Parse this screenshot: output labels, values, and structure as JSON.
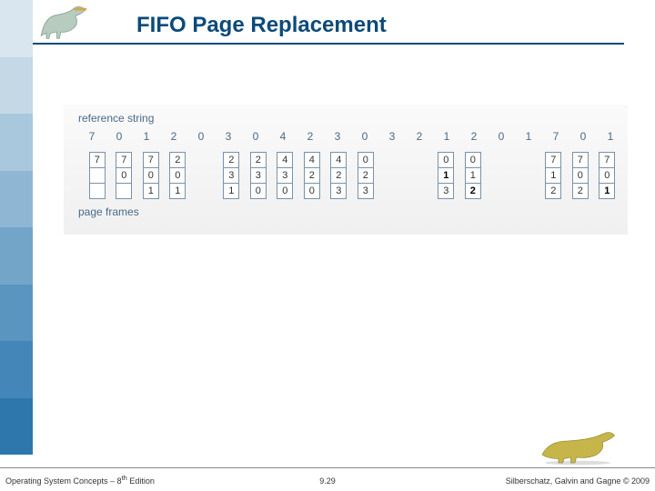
{
  "title": "FIFO Page Replacement",
  "labels": {
    "refstring": "reference string",
    "frames": "page frames"
  },
  "reference_string": [
    "7",
    "0",
    "1",
    "2",
    "0",
    "3",
    "0",
    "4",
    "2",
    "3",
    "0",
    "3",
    "2",
    "1",
    "2",
    "0",
    "1",
    "7",
    "0",
    "1"
  ],
  "columns": [
    {
      "show": true,
      "frames": [
        "7",
        "",
        ""
      ],
      "hl": [
        false,
        false,
        false
      ]
    },
    {
      "show": true,
      "frames": [
        "7",
        "0",
        ""
      ],
      "hl": [
        false,
        false,
        false
      ]
    },
    {
      "show": true,
      "frames": [
        "7",
        "0",
        "1"
      ],
      "hl": [
        false,
        false,
        false
      ]
    },
    {
      "show": true,
      "frames": [
        "2",
        "0",
        "1"
      ],
      "hl": [
        false,
        false,
        false
      ]
    },
    {
      "show": false
    },
    {
      "show": true,
      "frames": [
        "2",
        "3",
        "1"
      ],
      "hl": [
        false,
        false,
        false
      ]
    },
    {
      "show": true,
      "frames": [
        "2",
        "3",
        "0"
      ],
      "hl": [
        false,
        false,
        false
      ]
    },
    {
      "show": true,
      "frames": [
        "4",
        "3",
        "0"
      ],
      "hl": [
        false,
        false,
        false
      ]
    },
    {
      "show": true,
      "frames": [
        "4",
        "2",
        "0"
      ],
      "hl": [
        false,
        false,
        false
      ]
    },
    {
      "show": true,
      "frames": [
        "4",
        "2",
        "3"
      ],
      "hl": [
        false,
        false,
        false
      ]
    },
    {
      "show": true,
      "frames": [
        "0",
        "2",
        "3"
      ],
      "hl": [
        false,
        false,
        false
      ]
    },
    {
      "show": false
    },
    {
      "show": false
    },
    {
      "show": true,
      "frames": [
        "0",
        "1",
        "3"
      ],
      "hl": [
        false,
        true,
        false
      ]
    },
    {
      "show": true,
      "frames": [
        "0",
        "1",
        "2"
      ],
      "hl": [
        false,
        false,
        true
      ]
    },
    {
      "show": false
    },
    {
      "show": false
    },
    {
      "show": true,
      "frames": [
        "7",
        "1",
        "2"
      ],
      "hl": [
        false,
        false,
        false
      ]
    },
    {
      "show": true,
      "frames": [
        "7",
        "0",
        "2"
      ],
      "hl": [
        false,
        false,
        false
      ]
    },
    {
      "show": true,
      "frames": [
        "7",
        "0",
        "1"
      ],
      "hl": [
        false,
        false,
        true
      ]
    }
  ],
  "footer": {
    "left_prefix": "Operating System Concepts – 8",
    "left_sup": "th",
    "left_suffix": " Edition",
    "center": "9.29",
    "right": "Silberschatz, Galvin and Gagne © 2009"
  },
  "theme": {
    "stripe_colors": [
      "#d9e6ef",
      "#c4d8e6",
      "#a9c7dd",
      "#8fb7d3",
      "#73a5c9",
      "#5a95c0",
      "#4386b7",
      "#2e77ad"
    ],
    "title_color": "#0b4a7a"
  }
}
